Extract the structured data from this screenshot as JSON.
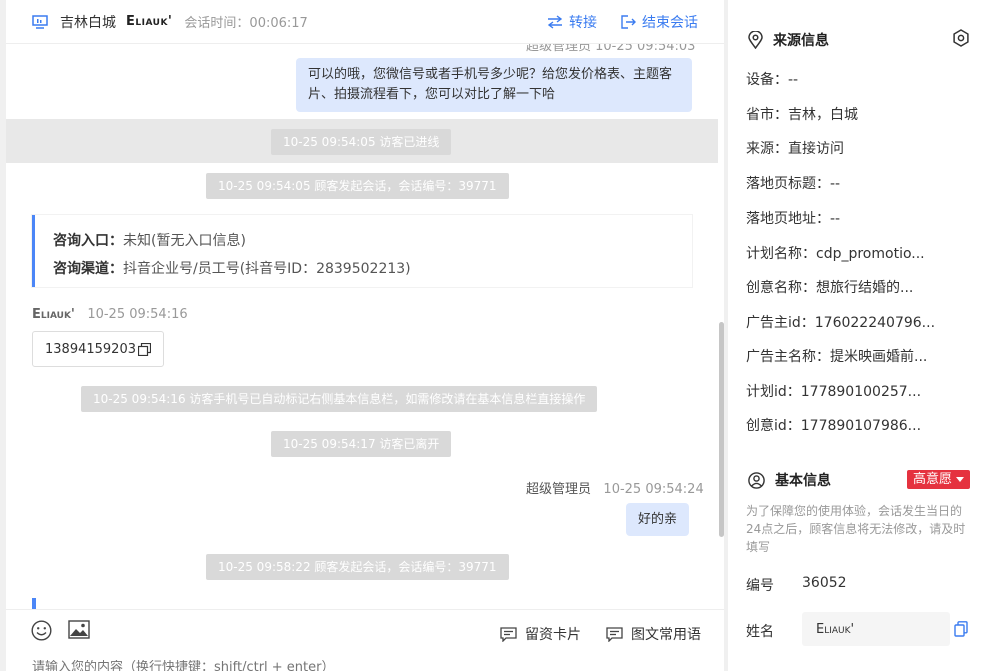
{
  "header": {
    "location": "吉林白城",
    "visitor_name": "Eliauk'",
    "session_time": "会话时间：00:06:17",
    "transfer_label": "转接",
    "end_label": "结束会话"
  },
  "messages": {
    "top_meta_cut": "超级管理员  10-25 09:54:03",
    "agent_bubble_1": "可以的哦，您微信号或者手机号多少呢？给您发价格表、主题客片、拍摄流程看下，您可以对比了解一下哈",
    "sys_1": "10-25 09:54:05 访客已进线",
    "sys_2": "10-25 09:54:05 顾客发起会话，会话编号：39771",
    "card": {
      "entry_label": "咨询入口：",
      "entry_value": "未知(暂无入口信息)",
      "channel_label": "咨询渠道：",
      "channel_value": "抖音企业号/员工号(抖音号ID：2839502213)"
    },
    "visitor_name": "Eliauk'",
    "visitor_time": "10-25 09:54:16",
    "phone": "13894159203",
    "sys_3": "10-25 09:54:16 访客手机号已自动标记右侧基本信息栏，如需修改请在基本信息栏直接操作",
    "sys_4": "10-25 09:54:17 访客已离开",
    "agent_name": "超级管理员",
    "agent_time": "10-25 09:54:24",
    "agent_bubble_2": "好的亲",
    "sys_5": "10-25 09:58:22 顾客发起会话，会话编号：39771"
  },
  "composer": {
    "lead_card_label": "留资卡片",
    "quick_reply_label": "图文常用语",
    "placeholder": "请输入您的内容（换行快捷键：shift/ctrl + enter）"
  },
  "source_info": {
    "title": "来源信息",
    "rows": [
      "设备：--",
      "省市：吉林，白城",
      "来源：直接访问",
      "落地页标题：--",
      "落地页地址：--",
      "计划名称：cdp_promotio...",
      "创意名称：想旅行结婚的...",
      "广告主id：176022240796...",
      "广告主名称：提米映画婚前...",
      "计划id：177890100257...",
      "创意id：177890107986..."
    ]
  },
  "basic_info": {
    "title": "基本信息",
    "intent_badge": "高意愿",
    "notice": "为了保障您的使用体验，会话发生当日的24点之后，顾客信息将无法修改，请及时填写",
    "id_label": "编号",
    "id_value": "36052",
    "name_label": "姓名",
    "name_value": "Eliauk'"
  },
  "colors": {
    "accent": "#3b7cf0",
    "agent_bubble": "#dde8fd",
    "system_pill": "#d9d9d9",
    "intent_red": "#e5323f"
  }
}
